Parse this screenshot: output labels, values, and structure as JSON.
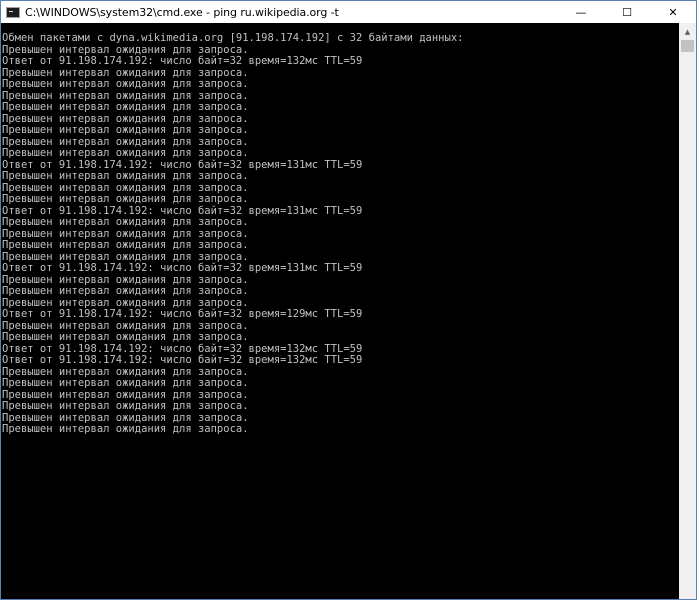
{
  "window": {
    "title": "C:\\WINDOWS\\system32\\cmd.exe - ping  ru.wikipedia.org -t",
    "minimize": "—",
    "maximize": "☐",
    "close": "✕"
  },
  "console": {
    "lines": [
      "Обмен пакетами с dyna.wikimedia.org [91.198.174.192] с 32 байтами данных:",
      "Превышен интервал ожидания для запроса.",
      "Ответ от 91.198.174.192: число байт=32 время=132мс TTL=59",
      "Превышен интервал ожидания для запроса.",
      "Превышен интервал ожидания для запроса.",
      "Превышен интервал ожидания для запроса.",
      "Превышен интервал ожидания для запроса.",
      "Превышен интервал ожидания для запроса.",
      "Превышен интервал ожидания для запроса.",
      "Превышен интервал ожидания для запроса.",
      "Превышен интервал ожидания для запроса.",
      "Ответ от 91.198.174.192: число байт=32 время=131мс TTL=59",
      "Превышен интервал ожидания для запроса.",
      "Превышен интервал ожидания для запроса.",
      "Превышен интервал ожидания для запроса.",
      "Ответ от 91.198.174.192: число байт=32 время=131мс TTL=59",
      "Превышен интервал ожидания для запроса.",
      "Превышен интервал ожидания для запроса.",
      "Превышен интервал ожидания для запроса.",
      "Превышен интервал ожидания для запроса.",
      "Ответ от 91.198.174.192: число байт=32 время=131мс TTL=59",
      "Превышен интервал ожидания для запроса.",
      "Превышен интервал ожидания для запроса.",
      "Превышен интервал ожидания для запроса.",
      "Ответ от 91.198.174.192: число байт=32 время=129мс TTL=59",
      "Превышен интервал ожидания для запроса.",
      "Превышен интервал ожидания для запроса.",
      "Ответ от 91.198.174.192: число байт=32 время=132мс TTL=59",
      "Ответ от 91.198.174.192: число байт=32 время=132мс TTL=59",
      "Превышен интервал ожидания для запроса.",
      "Превышен интервал ожидания для запроса.",
      "Превышен интервал ожидания для запроса.",
      "Превышен интервал ожидания для запроса.",
      "Превышен интервал ожидания для запроса.",
      "Превышен интервал ожидания для запроса."
    ]
  },
  "scrollbar": {
    "up_arrow": "▲"
  }
}
